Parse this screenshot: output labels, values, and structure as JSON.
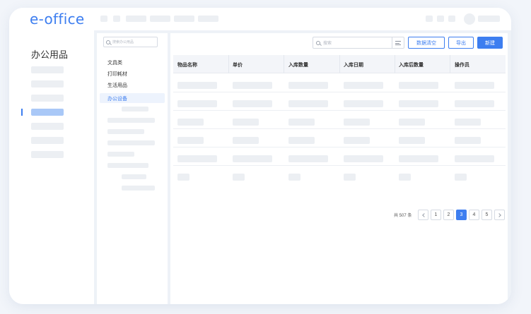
{
  "app": {
    "logo": "e-office"
  },
  "sidebar": {
    "title": "办公用品"
  },
  "tree": {
    "search_placeholder": "搜索办公用品",
    "items": [
      "文具类",
      "打印耗材",
      "生活用品",
      "办公设备"
    ],
    "active_index": 3
  },
  "toolbar": {
    "search_placeholder": "搜索",
    "clear_label": "数据清空",
    "export_label": "导出",
    "new_label": "新建"
  },
  "table": {
    "columns": [
      "物品名称",
      "单价",
      "入库数量",
      "入库日期",
      "入库后数量",
      "操作员"
    ]
  },
  "pagination": {
    "total_text": "共 507 条",
    "pages": [
      "1",
      "2",
      "3",
      "4",
      "5"
    ],
    "current": "3"
  },
  "colors": {
    "accent": "#3d7ef0"
  }
}
